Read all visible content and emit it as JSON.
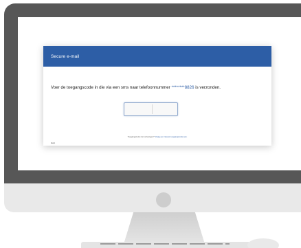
{
  "dialog": {
    "title": "Secure e-mail",
    "message_prefix": "Voer de toegangscode in die via een sms naar telefoonnummer",
    "masked_phone": "********8826",
    "message_suffix": "is verzonden.",
    "resend_prompt": "Toegangscode niet ontvangen?",
    "resend_link": "Vraag een nieuwe toegangscode aan.",
    "help_label": "Help"
  },
  "colors": {
    "header": "#2d5ea6",
    "link": "#2d5ea6",
    "monitor_bezel": "#575757",
    "monitor_chin": "#e9e9e9"
  }
}
